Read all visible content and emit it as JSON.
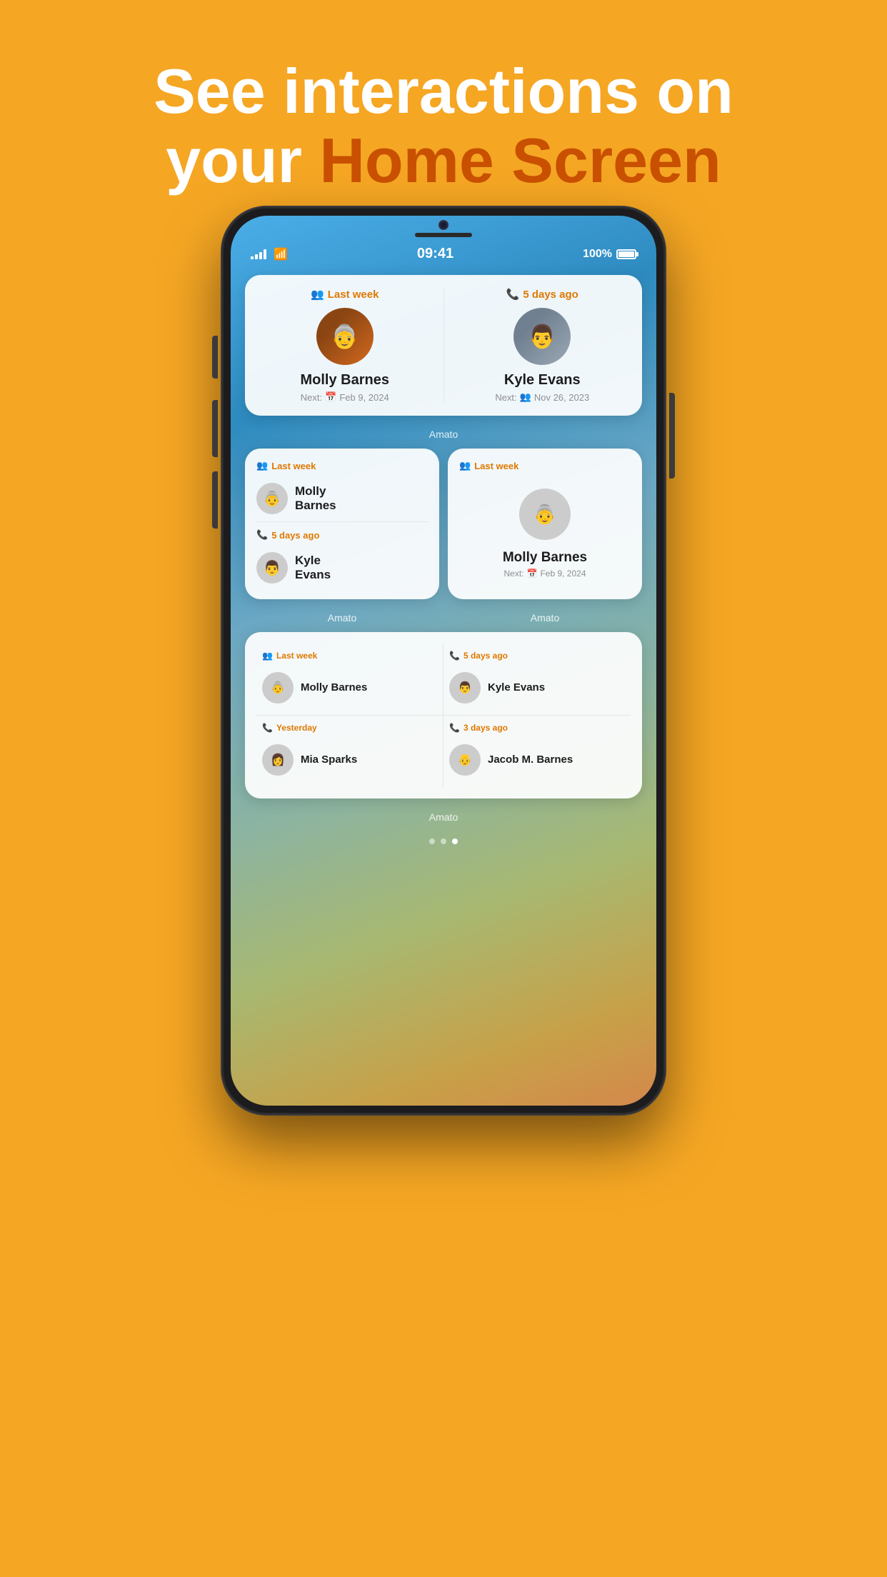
{
  "header": {
    "line1": "See interactions on",
    "line2_prefix": "your ",
    "line2_highlight": "Home Screen"
  },
  "statusBar": {
    "time": "09:41",
    "battery": "100%",
    "signal": "full",
    "wifi": true
  },
  "widgets": {
    "large": {
      "contact1": {
        "timeBadge": "Last week",
        "badgeType": "people",
        "name": "Molly Barnes",
        "nextLabel": "Next:",
        "nextDate": "Feb 9, 2024",
        "nextType": "calendar",
        "avatarEmoji": "👵"
      },
      "contact2": {
        "timeBadge": "5 days ago",
        "badgeType": "phone",
        "name": "Kyle Evans",
        "nextLabel": "Next:",
        "nextDate": "Nov 26, 2023",
        "nextType": "people",
        "avatarEmoji": "👨"
      },
      "label": "Amato"
    },
    "mediumList": {
      "contact1": {
        "timeBadge": "Last week",
        "badgeType": "people",
        "name": "Molly\nBarnes",
        "avatarEmoji": "👵"
      },
      "contact2": {
        "timeBadge": "5 days ago",
        "badgeType": "phone",
        "name": "Kyle\nEvans",
        "avatarEmoji": "👨"
      },
      "label": "Amato"
    },
    "mediumFocus": {
      "timeBadge": "Last week",
      "badgeType": "people",
      "name": "Molly Barnes",
      "nextLabel": "Next:",
      "nextDate": "Feb 9, 2024",
      "nextType": "calendar",
      "avatarEmoji": "👵",
      "label": "Amato"
    },
    "grid": {
      "cells": [
        {
          "timeBadge": "Last week",
          "badgeType": "people",
          "name": "Molly Barnes",
          "avatarEmoji": "👵"
        },
        {
          "timeBadge": "5 days ago",
          "badgeType": "phone",
          "name": "Kyle Evans",
          "avatarEmoji": "👨"
        },
        {
          "timeBadge": "Yesterday",
          "badgeType": "phone",
          "name": "Mia Sparks",
          "avatarEmoji": "👩"
        },
        {
          "timeBadge": "3 days ago",
          "badgeType": "phone",
          "name": "Jacob M. Barnes",
          "avatarEmoji": "👴"
        }
      ],
      "label": "Amato"
    },
    "pageDots": [
      "inactive",
      "active",
      "active"
    ]
  },
  "icons": {
    "people": "👥",
    "phone": "📞",
    "calendar": "📅"
  }
}
